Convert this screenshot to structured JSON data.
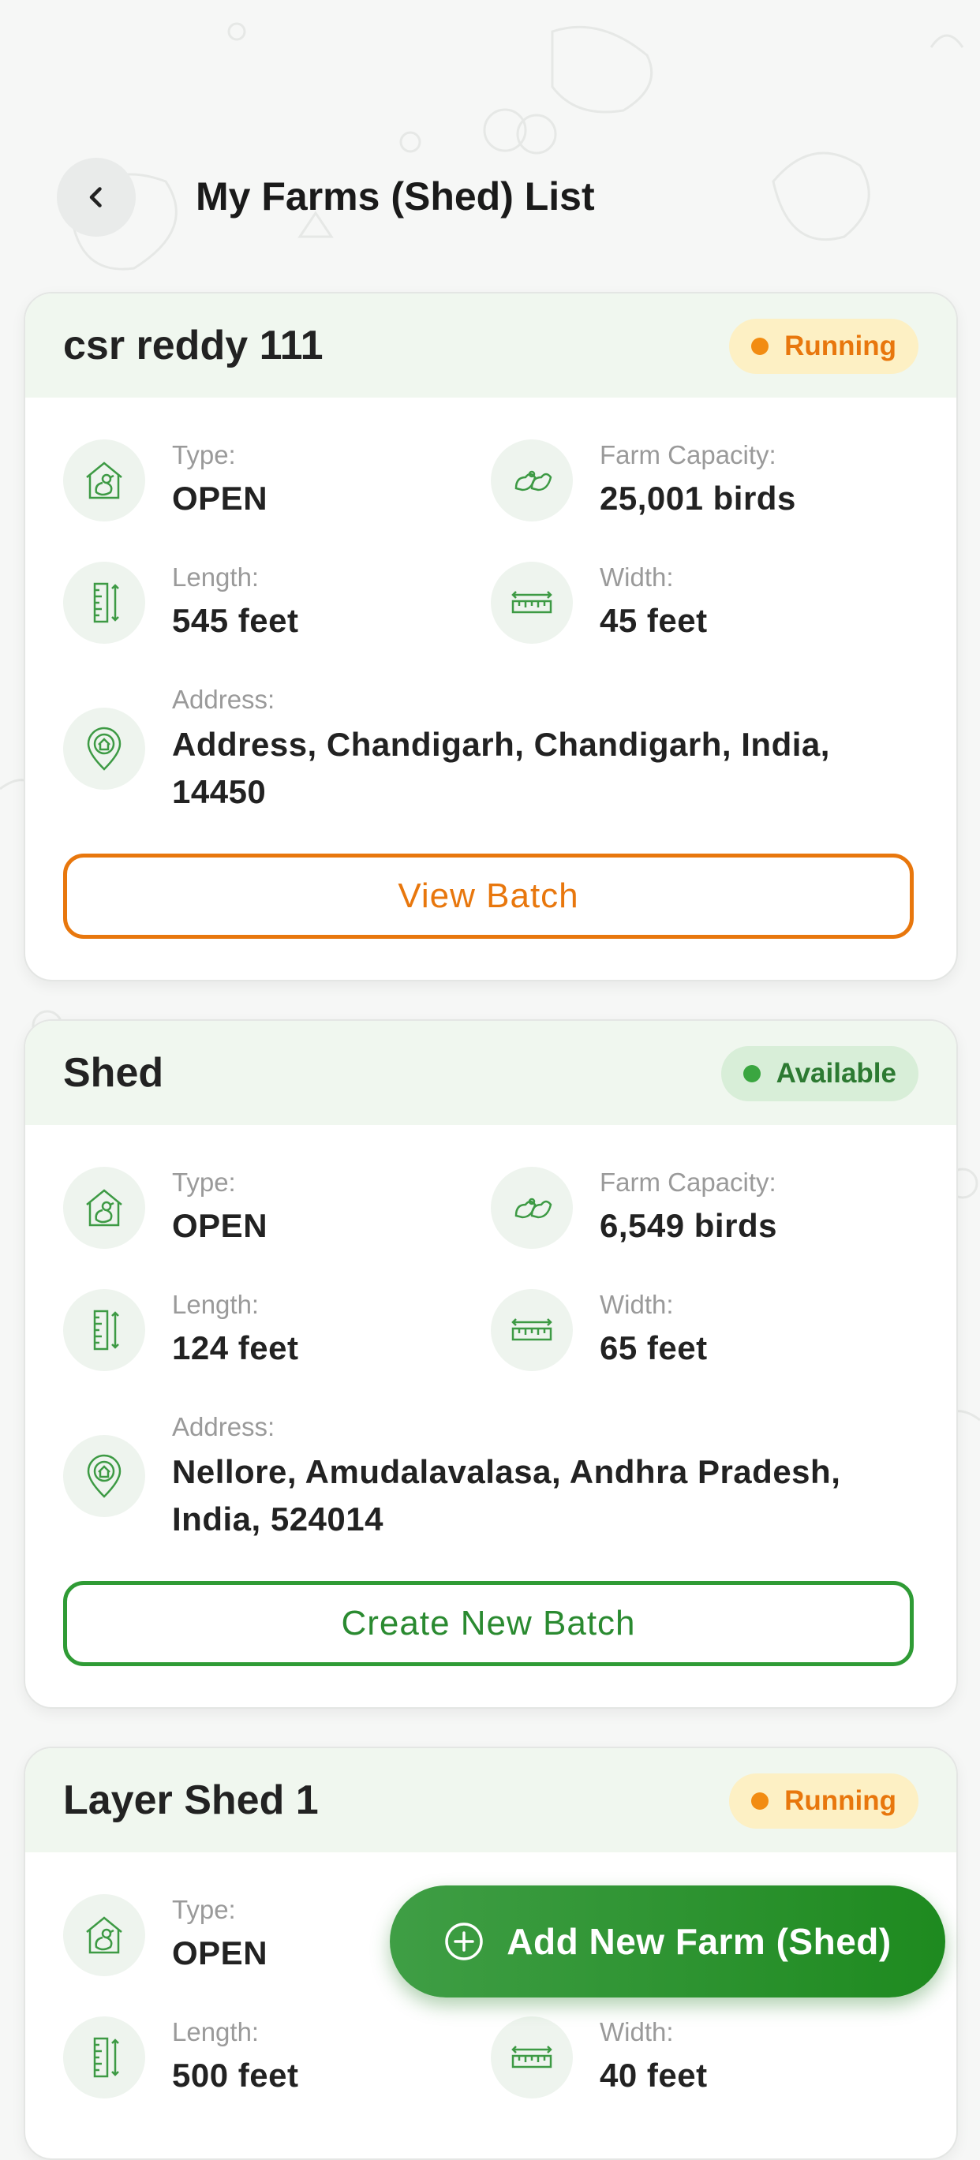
{
  "header": {
    "title": "My Farms (Shed) List"
  },
  "labels": {
    "type": "Type:",
    "capacity": "Farm Capacity:",
    "length": "Length:",
    "width": "Width:",
    "address": "Address:"
  },
  "farms": [
    {
      "name": "csr reddy 111",
      "status": "Running",
      "type": "OPEN",
      "capacity": "25,001 birds",
      "length": "545 feet",
      "width": "45 feet",
      "address": "Address, Chandigarh, Chandigarh, India, 14450",
      "action": "View Batch"
    },
    {
      "name": "Shed",
      "status": "Available",
      "type": "OPEN",
      "capacity": "6,549 birds",
      "length": "124 feet",
      "width": "65 feet",
      "address": "Nellore, Amudalavalasa, Andhra Pradesh, India, 524014",
      "action": "Create New Batch"
    },
    {
      "name": "Layer Shed 1",
      "status": "Running",
      "type": "OPEN",
      "length": "500 feet",
      "width": "40 feet"
    }
  ],
  "fab": {
    "label": "Add New Farm (Shed)"
  },
  "colors": {
    "running": "#e8770d",
    "available": "#2d7a32",
    "primary_green": "#2a8a30",
    "icon_green": "#3d9a44"
  },
  "icons": {
    "back": "chevron-left-icon",
    "type": "barn-chicken-icon",
    "capacity": "birds-icon",
    "length": "ruler-vertical-icon",
    "width": "ruler-horizontal-icon",
    "address": "home-location-pin-icon",
    "fab": "plus-circle-icon"
  }
}
